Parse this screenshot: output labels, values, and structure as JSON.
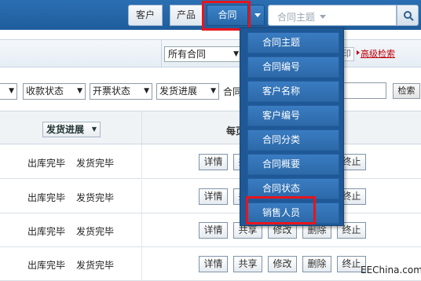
{
  "nav": {
    "customer": "客户",
    "product": "产品",
    "contract": "合同",
    "search_placeholder": "合同主题"
  },
  "filter": {
    "all_select": "所有合同",
    "print": "打印",
    "advanced_search": "高级检索",
    "selects": [
      "收款状态",
      "开票状态",
      "发货进展"
    ],
    "keyword_label": "合同主",
    "search_button": "检索"
  },
  "table": {
    "col_shipping": "发货进展",
    "col_ops": "每页显示10条",
    "rows": [
      {
        "stock": "出库完毕",
        "ship": "发货完毕"
      },
      {
        "stock": "出库完毕",
        "ship": "发货完毕"
      },
      {
        "stock": "出库完毕",
        "ship": "发货完毕"
      },
      {
        "stock": "出库完毕",
        "ship": "发货完毕"
      }
    ],
    "ops": {
      "detail": "详情",
      "share": "共享",
      "edit": "修改",
      "delete": "删除",
      "stop": "终止"
    }
  },
  "menu": {
    "items": [
      "合同主题",
      "合同编号",
      "客户名称",
      "客户编号",
      "合同分类",
      "合同概要",
      "合同状态",
      "销售人员"
    ]
  },
  "watermark": "EEChina.com"
}
